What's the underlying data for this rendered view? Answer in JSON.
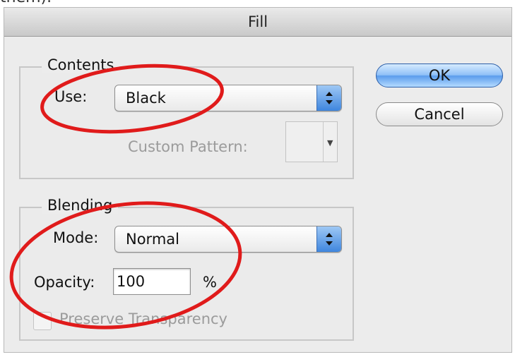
{
  "dialog": {
    "title": "Fill",
    "ok_label": "OK",
    "cancel_label": "Cancel"
  },
  "contents": {
    "group_label": "Contents",
    "use_label": "Use:",
    "use_value": "Black",
    "custom_pattern_label": "Custom Pattern:"
  },
  "blending": {
    "group_label": "Blending",
    "mode_label": "Mode:",
    "mode_value": "Normal",
    "opacity_label": "Opacity:",
    "opacity_value": "100",
    "opacity_unit": "%",
    "preserve_transparency_label": "Preserve Transparency",
    "preserve_transparency_checked": false
  },
  "colors": {
    "annotation_circle": "#e01b1b",
    "default_button": "#6aa9ef"
  }
}
